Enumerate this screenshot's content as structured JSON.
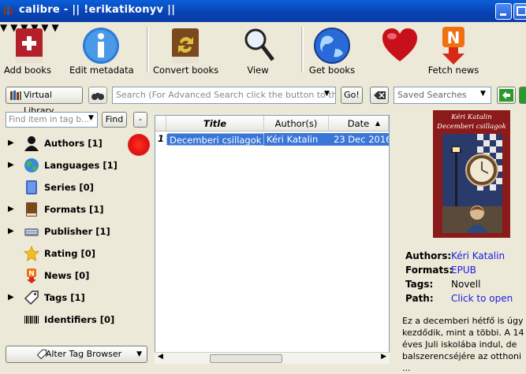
{
  "window": {
    "title": "calibre - || !erikatikonyv ||"
  },
  "toolbar": {
    "add_books": "Add books",
    "edit_metadata": "Edit metadata",
    "convert_books": "Convert books",
    "view": "View",
    "get_books": "Get books",
    "fetch_news": "Fetch news"
  },
  "searchbar": {
    "virtual_library": "Virtual Library",
    "search_placeholder": "Search (For Advanced Search click the button to th...",
    "go": "Go!",
    "saved_searches_placeholder": "Saved Searches"
  },
  "tag_browser": {
    "find_placeholder": "Find item in tag b...",
    "find_button": "Find",
    "collapse_button": "-",
    "items": [
      {
        "label": "Authors [1]",
        "icon": "person-icon",
        "expandable": true
      },
      {
        "label": "Languages [1]",
        "icon": "globe-icon",
        "expandable": true
      },
      {
        "label": "Series [0]",
        "icon": "series-icon",
        "expandable": false
      },
      {
        "label": "Formats [1]",
        "icon": "book-icon",
        "expandable": true
      },
      {
        "label": "Publisher [1]",
        "icon": "publisher-icon",
        "expandable": true
      },
      {
        "label": "Rating [0]",
        "icon": "star-icon",
        "expandable": false
      },
      {
        "label": "News [0]",
        "icon": "news-icon",
        "expandable": false
      },
      {
        "label": "Tags [1]",
        "icon": "tag-icon",
        "expandable": true
      },
      {
        "label": "Identifiers [0]",
        "icon": "barcode-icon",
        "expandable": false
      }
    ],
    "alter_button": "Alter Tag Browser"
  },
  "book_list": {
    "columns": [
      "Title",
      "Author(s)",
      "Date"
    ],
    "rows": [
      {
        "index": "1",
        "title": "Decemberi csillagok",
        "author": "Kéri Katalin",
        "date": "23 Dec 2016"
      }
    ]
  },
  "book_details": {
    "cover_author": "Kéri Katalin",
    "cover_title": "Decemberi csillagok",
    "fields": [
      {
        "key": "Authors:",
        "value": "Kéri Katalin",
        "link": true
      },
      {
        "key": "Formats:",
        "value": "EPUB",
        "link": true
      },
      {
        "key": "Tags:",
        "value": "Novell",
        "link": false
      },
      {
        "key": "Path:",
        "value": "Click to open",
        "link": true
      }
    ],
    "description": "Ez a decemberi hétfő is úgy kezdődik, mint a többi. A 14 éves Juli iskolába indul, de balszerencséjére az otthoni ..."
  },
  "colors": {
    "title_bar": "#0842b3",
    "selection": "#3a76d6",
    "link": "#1a1ae6",
    "cover": "#8b1a1a"
  }
}
